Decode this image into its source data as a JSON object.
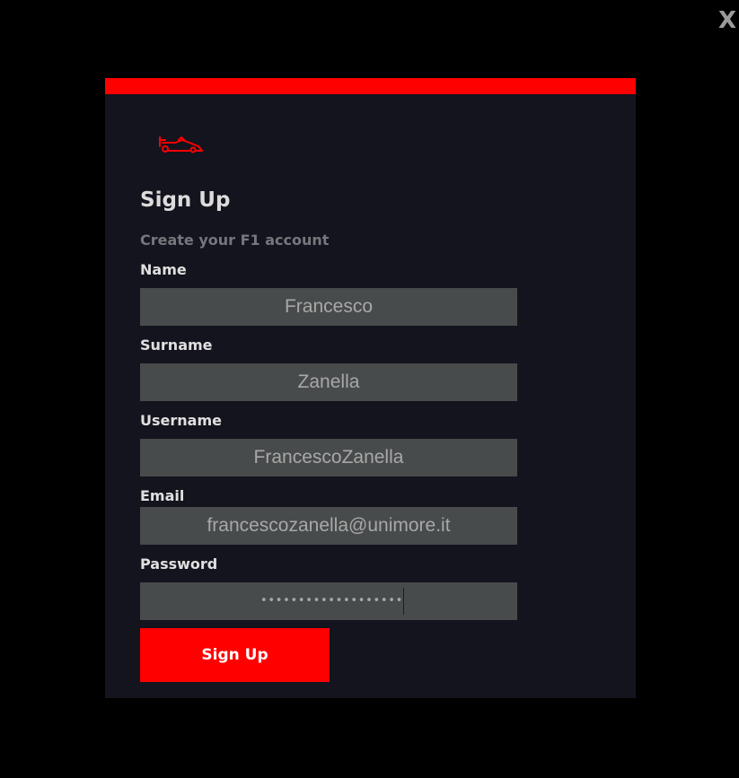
{
  "close_label": "X",
  "logo": {
    "icon": "f1-car-icon",
    "color": "#ff0000"
  },
  "form": {
    "title": "Sign Up",
    "subtitle": "Create your F1 account",
    "fields": [
      {
        "label": "Name",
        "value": "Francesco"
      },
      {
        "label": "Surname",
        "value": "Zanella"
      },
      {
        "label": "Username",
        "value": "FrancescoZanella"
      },
      {
        "label": "Email",
        "value": "francescozanella@unimore.it"
      },
      {
        "label": "Password",
        "masked_value": "•••••••••••••••••••"
      }
    ],
    "submit_label": "Sign Up"
  },
  "colors": {
    "accent": "#ff0000",
    "card_background": "#14141e",
    "input_background": "#474b4b"
  }
}
